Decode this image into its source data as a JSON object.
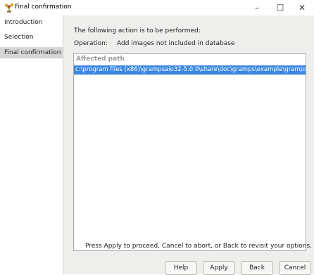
{
  "window": {
    "title": "Final confirmation",
    "controls": {
      "minimize": "–",
      "maximize": "☐",
      "close": "✕"
    },
    "icon": "gramps-app-icon"
  },
  "sidebar": {
    "items": [
      {
        "label": "Introduction",
        "active": false
      },
      {
        "label": "Selection",
        "active": false
      },
      {
        "label": "Final confirmation",
        "active": true
      }
    ]
  },
  "main": {
    "description": "The following action is to be performed:",
    "operation_label": "Operation:",
    "operation_value": "Add images not included in database",
    "list": {
      "header": "Affected path",
      "rows": [
        "c:\\program files (x86)\\grampsaio32-5.0.0\\share\\doc\\gramps\\example\\gramps"
      ]
    },
    "hint": "Press Apply to proceed, Cancel to abort, or Back to revisit your options."
  },
  "buttons": {
    "help": "Help",
    "apply": "Apply",
    "back": "Back",
    "cancel": "Cancel"
  },
  "colors": {
    "selection": "#3a87e0",
    "sidebar_active": "#d6d6d6",
    "panel_bg": "#eeeeec"
  }
}
